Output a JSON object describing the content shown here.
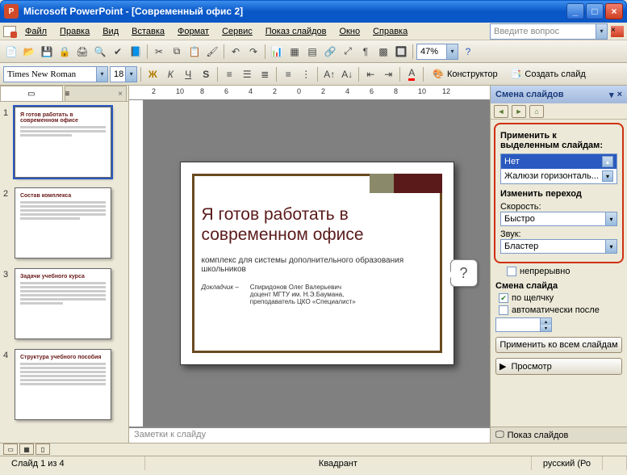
{
  "window": {
    "title": "Microsoft PowerPoint - [Современный офис 2]"
  },
  "ask_box_placeholder": "Введите вопрос",
  "menu": [
    "Файл",
    "Правка",
    "Вид",
    "Вставка",
    "Формат",
    "Сервис",
    "Показ слайдов",
    "Окно",
    "Справка"
  ],
  "toolbar_main": {
    "zoom": "47%"
  },
  "toolbar_fmt": {
    "font": "Times New Roman",
    "size": "18",
    "designer": "Конструктор",
    "newslide": "Создать слайд"
  },
  "ruler_ticks": [
    "2",
    "10",
    "8",
    "6",
    "4",
    "2",
    "0",
    "2",
    "4",
    "6",
    "8",
    "10",
    "12"
  ],
  "thumbs": [
    {
      "n": "1",
      "title": "Я готов работать в современном офисе"
    },
    {
      "n": "2",
      "title": "Состав комплекса"
    },
    {
      "n": "3",
      "title": "Задачи учебного курса"
    },
    {
      "n": "4",
      "title": "Структура учебного пособия"
    }
  ],
  "slide": {
    "title": "Я готов работать в современном офисе",
    "subtitle": "комплекс для системы дополнительного образования школьников",
    "speaker_label": "Докладчик –",
    "speaker": "Спиридонов Олег Валерьевич\nдоцент МГТУ им. Н.Э.Баумана,\nпреподаватель ЦКО «Специалист»"
  },
  "callout": "?",
  "notes_placeholder": "Заметки к слайду",
  "taskpane": {
    "title": "Смена слайдов",
    "apply_label": "Применить к выделенным слайдам:",
    "transitions": {
      "selected": "Нет",
      "other": "Жалюзи горизонталь..."
    },
    "modify_label": "Изменить переход",
    "speed_label": "Скорость:",
    "speed_value": "Быстро",
    "sound_label": "Звук:",
    "sound_value": "Бластер",
    "loop_label": "непрерывно",
    "advance_label": "Смена слайда",
    "on_click": "по щелчку",
    "auto_after": "автоматически после",
    "apply_all": "Применить ко всем слайдам",
    "preview": "Просмотр",
    "slideshow": "Показ слайдов"
  },
  "status": {
    "slide": "Слайд 1 из 4",
    "template": "Квадрант",
    "lang": "русский (Ро"
  }
}
